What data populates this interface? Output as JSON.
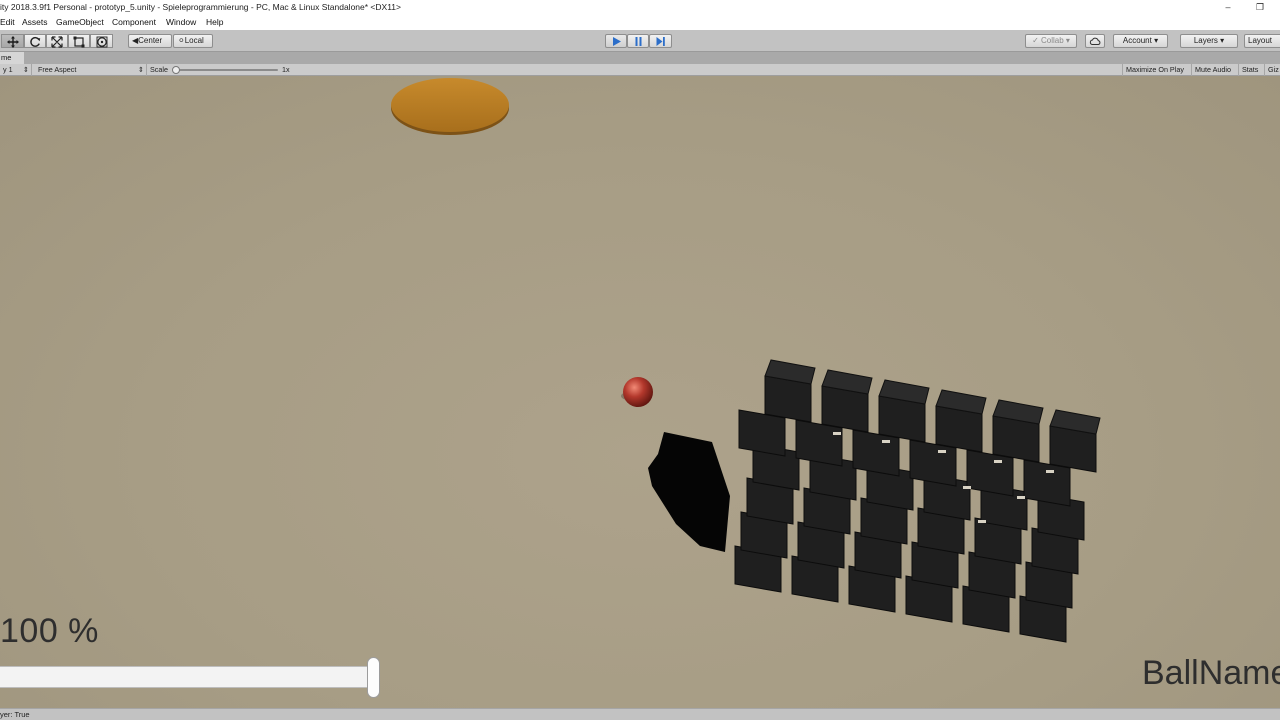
{
  "window": {
    "title": "ity 2018.3.9f1 Personal - prototyp_5.unity - Spieleprogrammierung - PC, Mac & Linux Standalone* <DX11>",
    "controls": [
      "minimize-icon",
      "restore-icon"
    ]
  },
  "menu": {
    "items": [
      "Edit",
      "Assets",
      "GameObject",
      "Component",
      "Window",
      "Help"
    ]
  },
  "toolbar": {
    "tools": [
      "move-tool-icon",
      "rotate-tool-icon",
      "scale-tool-icon",
      "rect-tool-icon",
      "transform-tool-icon"
    ],
    "pivot_center": "Center",
    "pivot_local": "Local",
    "playback": [
      "play-icon",
      "pause-icon",
      "step-icon"
    ],
    "collab": "Collab",
    "account": "Account",
    "layers": "Layers",
    "layout": "Layout"
  },
  "game_tab": {
    "label": "me"
  },
  "game_toolbar": {
    "display": "y 1",
    "aspect": "Free Aspect",
    "scale_label": "Scale",
    "scale_value": "1x",
    "maximize_on_play": "Maximize On Play",
    "mute_audio": "Mute Audio",
    "stats": "Stats",
    "gizmos": "Giz"
  },
  "game_view": {
    "percent_text": "100 %",
    "ball_name": "BallName",
    "slider_value": 1.0,
    "colors": {
      "ground": "#a79d85",
      "disc": "#ba7f25",
      "ball": "#b3382c",
      "blocks": "#1f1f1f"
    }
  },
  "status": {
    "text": "yer: True"
  }
}
